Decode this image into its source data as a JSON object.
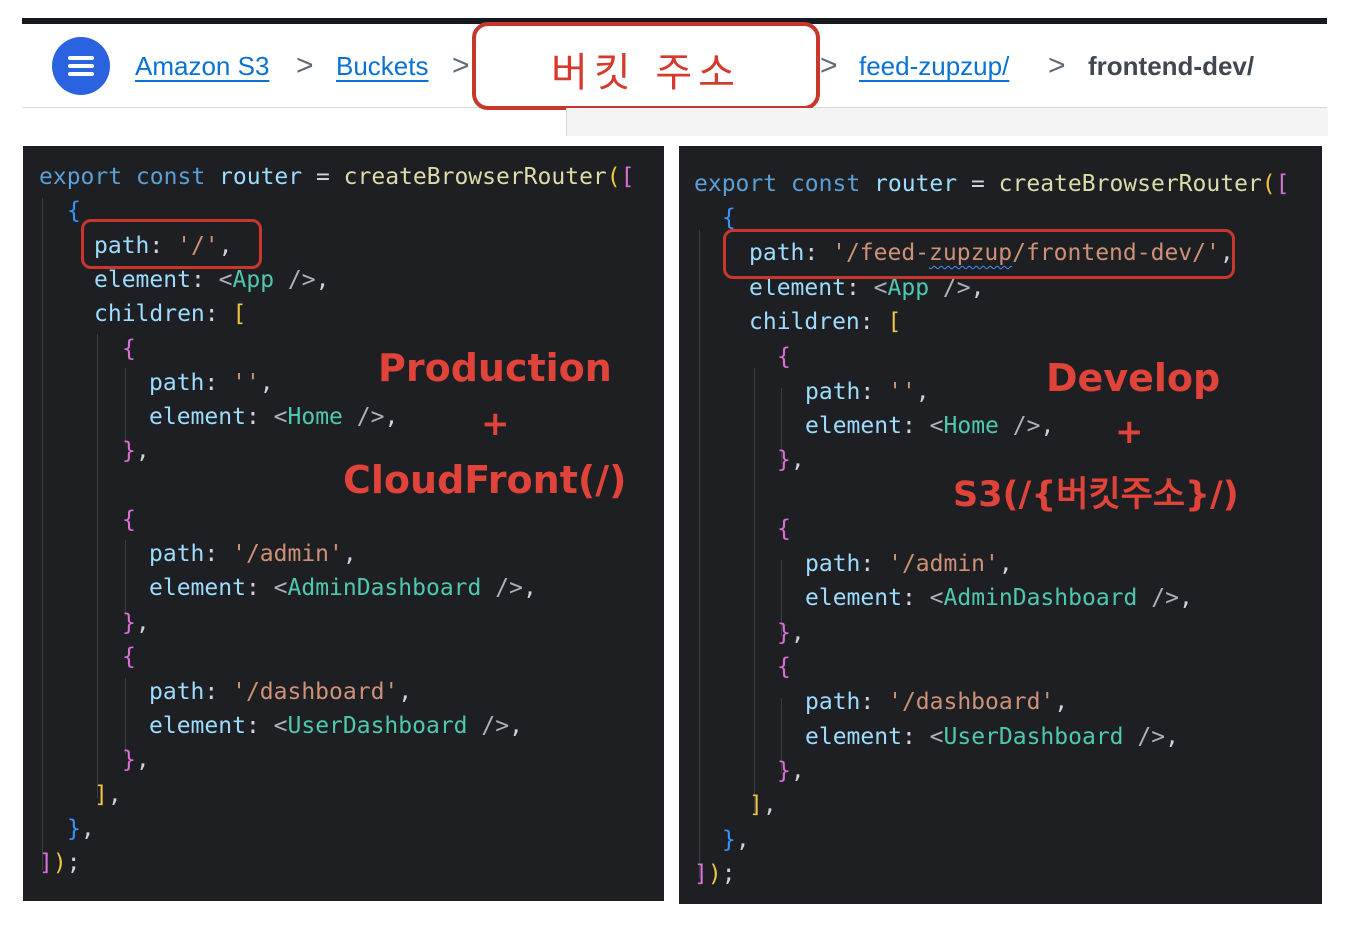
{
  "breadcrumb": {
    "items": [
      "Amazon S3",
      "Buckets",
      "feed-zupzup/",
      "frontend-dev/"
    ],
    "separator": ">"
  },
  "callout": {
    "bucket_address": "버킷 주소"
  },
  "left_code": {
    "lines": [
      "export const router = createBrowserRouter([",
      "{",
      "path: '/',",
      "element: <App />,",
      "children: [",
      "{",
      "path: '',",
      "element: <Home />,",
      "},",
      "{",
      "path: '/admin',",
      "element: <AdminDashboard />,",
      "},",
      "{",
      "path: '/dashboard',",
      "element: <UserDashboard />,",
      "},",
      "],",
      "},",
      "]);"
    ],
    "annotation": {
      "title": "Production",
      "plus": "+",
      "target": "CloudFront(/)"
    }
  },
  "right_code": {
    "lines": [
      "export const router = createBrowserRouter([",
      "{",
      "path: '/feed-zupzup/frontend-dev/',",
      "element: <App />,",
      "children: [",
      "{",
      "path: '',",
      "element: <Home />,",
      "},",
      "{",
      "path: '/admin',",
      "element: <AdminDashboard />,",
      "},",
      "{",
      "path: '/dashboard',",
      "element: <UserDashboard />,",
      "},",
      "],",
      "},",
      "]);"
    ],
    "annotation": {
      "title": "Develop",
      "plus": "+",
      "target": "S3(/{버킷주소}/)"
    }
  },
  "colors": {
    "keyword": "#5a9fd6",
    "function": "#dcdcaa",
    "property": "#9cdcfe",
    "string": "#ce9178",
    "component": "#4ec9b0",
    "annotation_red": "#e0433a",
    "link_blue": "#0972d3"
  },
  "icons": {
    "menu": "hamburger-menu-icon"
  }
}
